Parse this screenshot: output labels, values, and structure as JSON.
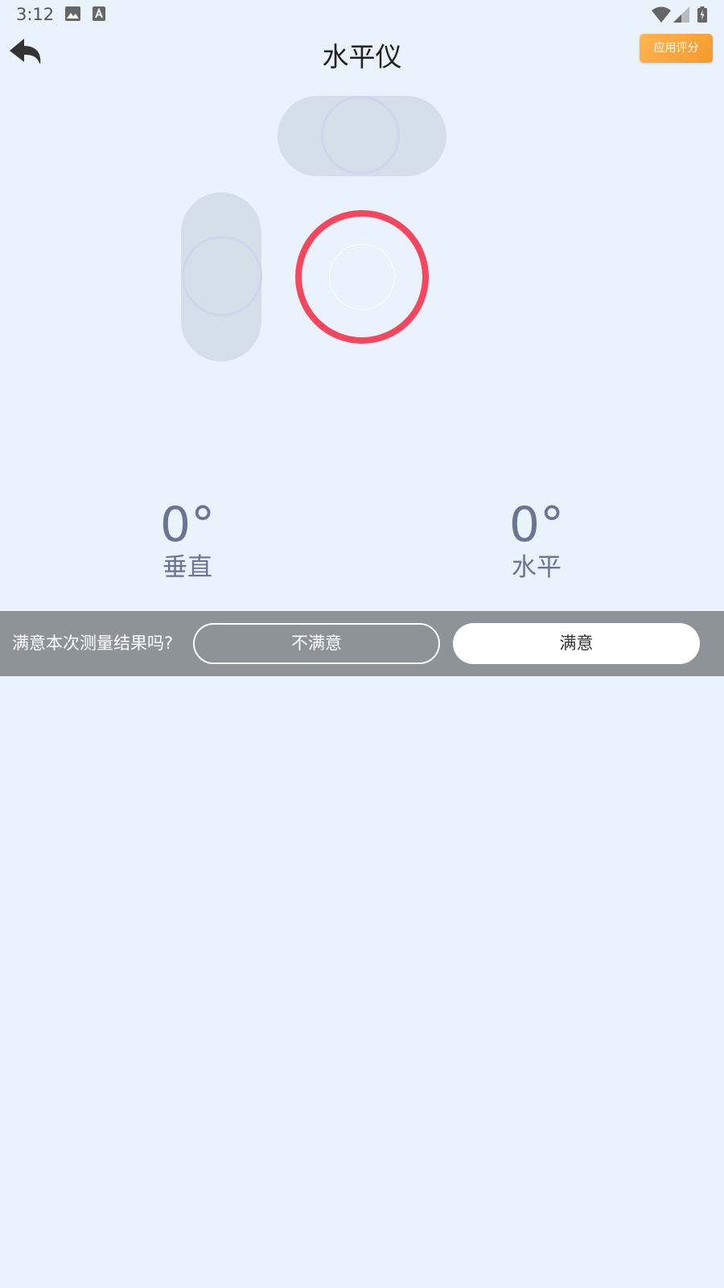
{
  "status_bar": {
    "time": "3:12",
    "icons": [
      "image-icon",
      "text-a-icon",
      "wifi-icon",
      "signal-icon",
      "battery-charging-icon"
    ]
  },
  "header": {
    "back_icon": "back-arrow-icon",
    "title": "水平仪",
    "rate_button_label": "应用评分"
  },
  "readings": {
    "vertical": {
      "value": "0°",
      "label": "垂直"
    },
    "horizontal": {
      "value": "0°",
      "label": "水平"
    }
  },
  "feedback": {
    "question": "满意本次测量结果吗?",
    "unsatisfied_label": "不满意",
    "satisfied_label": "满意"
  },
  "colors": {
    "background": "#eaf2fb",
    "target_ring": "#f6465d",
    "reading_text": "#6a7494",
    "rate_button": "#f7982a",
    "feedback_bar": "#8e9398"
  }
}
